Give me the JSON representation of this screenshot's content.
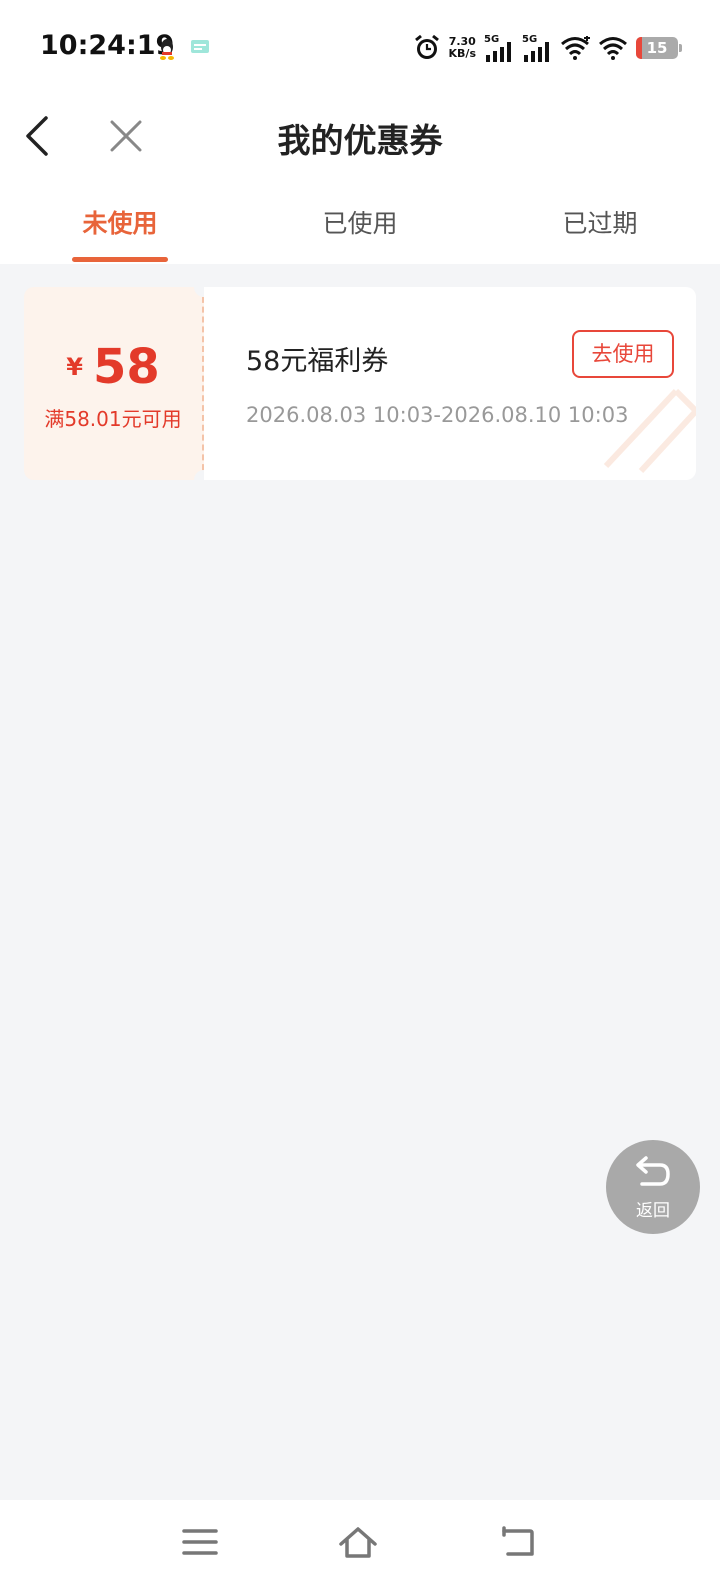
{
  "status_bar": {
    "time": "10:24:19",
    "net_speed_value": "7.30",
    "net_speed_unit": "KB/s",
    "sim1_label": "5G",
    "sim2_label": "5G",
    "battery": "15",
    "icons": [
      "qq-icon",
      "message-icon",
      "alarm-icon",
      "signal-icon",
      "signal-icon",
      "wifi-icon",
      "wifi-icon",
      "battery-icon"
    ]
  },
  "nav": {
    "title": "我的优惠券"
  },
  "tabs": [
    {
      "label": "未使用",
      "active": true
    },
    {
      "label": "已使用",
      "active": false
    },
    {
      "label": "已过期",
      "active": false
    }
  ],
  "coupon": {
    "currency": "¥",
    "value": "58",
    "threshold": "满58.01元可用",
    "name": "58元福利券",
    "date_range": "2026.08.03 10:03-2026.08.10 10:03",
    "action_label": "去使用"
  },
  "float_back": {
    "label": "返回"
  },
  "colors": {
    "accent": "#e8643a",
    "coupon_red": "#e33a2a",
    "background": "#f4f5f7"
  }
}
